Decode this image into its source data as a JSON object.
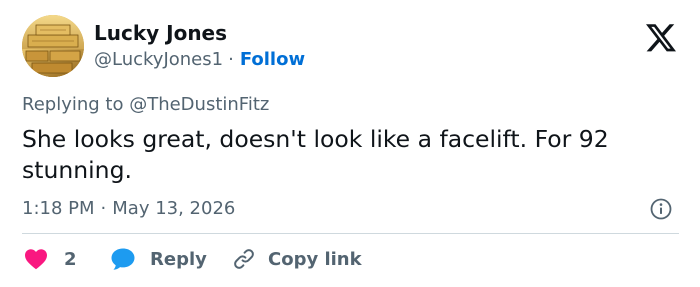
{
  "author": {
    "display_name": "Lucky Jones",
    "handle": "@LuckyJones1",
    "separator": "·",
    "follow_label": "Follow",
    "avatar_icon": "gold-bars-avatar"
  },
  "brand": {
    "logo_icon": "x-logo-icon"
  },
  "tweet": {
    "replying_to": "Replying to @TheDustinFitz",
    "text": "She looks great, doesn't look like a facelift. For 92 stunning.",
    "time": "1:18 PM",
    "date_separator": "·",
    "date": "May 13, 2026"
  },
  "actions": {
    "like_count": "2",
    "reply_label": "Reply",
    "copy_link_label": "Copy link"
  },
  "colors": {
    "like": "#f91880",
    "reply": "#1d9bf0",
    "follow": "#006fd6",
    "secondary_text": "#536471",
    "divider": "#cfd9de"
  }
}
